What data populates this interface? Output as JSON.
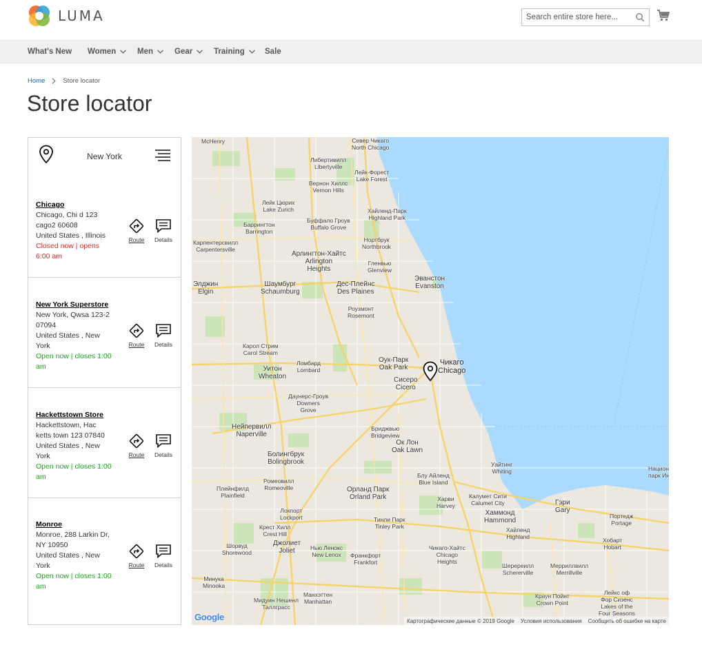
{
  "brand": {
    "name": "LUMA"
  },
  "search": {
    "placeholder": "Search entire store here..."
  },
  "nav": {
    "items": [
      {
        "label": "What's New",
        "dropdown": false
      },
      {
        "label": "Women",
        "dropdown": true
      },
      {
        "label": "Men",
        "dropdown": true
      },
      {
        "label": "Gear",
        "dropdown": true
      },
      {
        "label": "Training",
        "dropdown": true
      },
      {
        "label": "Sale",
        "dropdown": false
      }
    ]
  },
  "breadcrumb": {
    "home": "Home",
    "current": "Store locator"
  },
  "page": {
    "title": "Store locator"
  },
  "locator": {
    "search_city": "New York",
    "route_label": "Route",
    "details_label": "Details",
    "stores": [
      {
        "name": "Chicago",
        "address_lines": [
          "Chicago, Chi d 123",
          "cago2 60608",
          "United States , Illinois"
        ],
        "status_lines": [
          "Closed now | opens",
          "6:00 am"
        ],
        "status": "closed"
      },
      {
        "name": "New York Superstore",
        "address_lines": [
          "New York, Qwsa 123-2",
          "07094",
          "United States , New",
          "York"
        ],
        "status_lines": [
          "Open now | closes 1:00",
          "am"
        ],
        "status": "open"
      },
      {
        "name": "Hackettstown Store",
        "address_lines": [
          "Hackettstown, Hac",
          "ketts town 123 07840",
          "United States , New",
          "York"
        ],
        "status_lines": [
          "Open now | closes 1:00",
          "am"
        ],
        "status": "open"
      },
      {
        "name": "Monroe",
        "address_lines": [
          "Monroe, 288 Larkin Dr,",
          "NY 10950",
          "United States , New",
          "York"
        ],
        "status_lines": [
          "Open now | closes 1:00",
          "am"
        ],
        "status": "open"
      }
    ]
  },
  "map": {
    "google_logo": "Google",
    "attribution": {
      "data": "Картографические данные © 2019 Google",
      "terms": "Условия использования",
      "report": "Сообщить об ошибке на карте"
    },
    "labels": [
      "McHenry",
      "Север Чикаго\nNorth Chicago",
      "Либертивилл\nLibertyville",
      "Лейк-Форест\nLake Forest",
      "Лейк Цюрих\nLake Zurich",
      "Вернон Хиллс\nVernon Hills",
      "Хайленд-Парк\nHighland Park",
      "Баррингтон\nBarrington",
      "Буффало Гроув\nBuffalo Grove",
      "Нортбрук\nNorthbrook",
      "Карпентерсвилл\nCarpentersville",
      "Арлингтон-Хайтс\nArlington\nHeights",
      "Гленвью\nGlenview",
      "Эванстон\nEvanston",
      "Шаумбург\nSchaumburg",
      "Дес-Плейнс\nDes Plaines",
      "Элджин\nElgin",
      "Роузмонт\nRosemont",
      "Карол Стрим\nCarol Stream",
      "Оук-Парк\nOak Park",
      "Чикаго\nChicago",
      "Уитон\nWheaton",
      "Ломбард\nLombard",
      "Сисеро\nCicero",
      "Даунерс-Гроув\nDowners\nGrove",
      "Нейпервилл\nNaperville",
      "Бриджвью\nBridgeview",
      "Ок Лон\nOak Lawn",
      "Болингбрук\nBolingbrook",
      "Ромеовилл\nRomeoville",
      "Плейнфилд\nPlainfield",
      "Блу Айленд\nBlue Island",
      "Орланд Парк\nOrland Park",
      "Харви\nHarvey",
      "Уайтинг\nWhiting",
      "Калумет Сити\nCalumet City",
      "Хаммонд\nHammond",
      "Гэри\nGary",
      "Портедж\nPortage",
      "Локпорт\nLockport",
      "Тинли Парк\nTinley Park",
      "Крест Хилл\nCrest Hill",
      "Хайленд\nHighland",
      "Шорвуд\nShorewood",
      "Джолиет\nJoliet",
      "Франкфорт\nFrankfort",
      "Чикаго-Хайтс\nChicago\nHeights",
      "Нью Ленокс\nNew Lenox",
      "Шеререилл\nSchererville",
      "Мерриллвилл\nMerrillville",
      "Хобарт\nHobart",
      "Минука\nMinooka",
      "Манхэттен\nManhattan",
      "Мидуин Нешенл\nТаллграсс",
      "Краун Пойнт\nCrown Point",
      "Лейкс оф\nФор Сизенс\nLakes of the\nFour Seasons",
      "Национ\nпарк Ин",
      "Chicago",
      "Wheaton",
      "Evanston",
      "Oak Lawn"
    ]
  },
  "colors": {
    "link": "#006bb4",
    "closed": "#e02b27",
    "open": "#1aa51a",
    "water": "#aadaff",
    "nav_bg": "#f0f0f0"
  }
}
